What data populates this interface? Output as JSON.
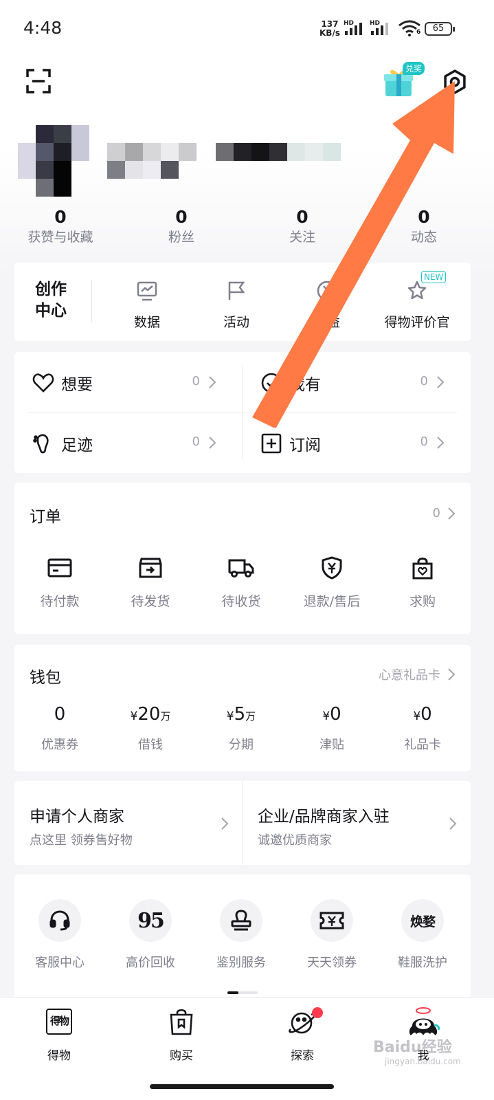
{
  "status_bar": {
    "time": "4:48",
    "speed_value": "137",
    "speed_unit": "KB/s",
    "hd1": "HD",
    "hd2": "HD",
    "wifi_badge": "6",
    "battery": "65"
  },
  "header": {
    "gift_badge": "兑奖"
  },
  "stats": [
    {
      "value": "0",
      "label": "获赞与收藏"
    },
    {
      "value": "0",
      "label": "粉丝"
    },
    {
      "value": "0",
      "label": "关注"
    },
    {
      "value": "0",
      "label": "动态"
    }
  ],
  "creator": {
    "title": "创作中心",
    "items": [
      {
        "label": "数据",
        "icon": "chart-icon"
      },
      {
        "label": "活动",
        "icon": "flag-icon"
      },
      {
        "label": "收益",
        "icon": "yuan-coin-icon"
      },
      {
        "label": "得物评价官",
        "icon": "star-pen-icon",
        "badge": "NEW"
      }
    ]
  },
  "collections": [
    {
      "label": "想要",
      "count": "0",
      "icon": "heart-icon"
    },
    {
      "label": "我有",
      "count": "0",
      "icon": "check-circle-icon"
    },
    {
      "label": "足迹",
      "count": "0",
      "icon": "footprint-icon"
    },
    {
      "label": "订阅",
      "count": "0",
      "icon": "subscribe-plus-icon"
    }
  ],
  "orders": {
    "title": "订单",
    "count": "0",
    "items": [
      {
        "label": "待付款",
        "icon": "card-icon"
      },
      {
        "label": "待发货",
        "icon": "box-icon"
      },
      {
        "label": "待收货",
        "icon": "truck-icon"
      },
      {
        "label": "退款/售后",
        "icon": "shield-yuan-icon"
      },
      {
        "label": "求购",
        "icon": "bag-heart-icon"
      }
    ]
  },
  "wallet": {
    "title": "钱包",
    "right_link": "心意礼品卡",
    "items": [
      {
        "currency": "",
        "amount": "0",
        "unit": "",
        "label": "优惠券"
      },
      {
        "currency": "¥",
        "amount": "20",
        "unit": "万",
        "label": "借钱"
      },
      {
        "currency": "¥",
        "amount": "5",
        "unit": "万",
        "label": "分期"
      },
      {
        "currency": "¥",
        "amount": "0",
        "unit": "",
        "label": "津贴"
      },
      {
        "currency": "¥",
        "amount": "0",
        "unit": "",
        "label": "礼品卡"
      }
    ]
  },
  "merchant": [
    {
      "title": "申请个人商家",
      "subtitle": "点这里 领券售好物"
    },
    {
      "title": "企业/品牌商家入驻",
      "subtitle": "诚邀优质商家"
    }
  ],
  "services": [
    {
      "label": "客服中心",
      "icon": "headset-icon"
    },
    {
      "label": "高价回收",
      "icon": "recycle-95-icon",
      "glyph": "95"
    },
    {
      "label": "鉴别服务",
      "icon": "stamp-icon"
    },
    {
      "label": "天天领券",
      "icon": "ticket-icon"
    },
    {
      "label": "鞋服洗护",
      "icon": "wash-care-icon",
      "glyph": "焕婺"
    }
  ],
  "tabbar": [
    {
      "label": "得物",
      "icon": "dewu-logo-icon",
      "glyph": "得物"
    },
    {
      "label": "购买",
      "icon": "shopping-bag-icon"
    },
    {
      "label": "探索",
      "icon": "planet-icon"
    },
    {
      "label": "我",
      "icon": "avatar-octopus-icon"
    }
  ],
  "watermark": {
    "text": "Baidu经验",
    "sub": "jingyan.baidu.com"
  },
  "colors": {
    "accent": "#1fc4c4",
    "arrow": "#ff7a45",
    "badge_red": "#ff3b4e"
  }
}
